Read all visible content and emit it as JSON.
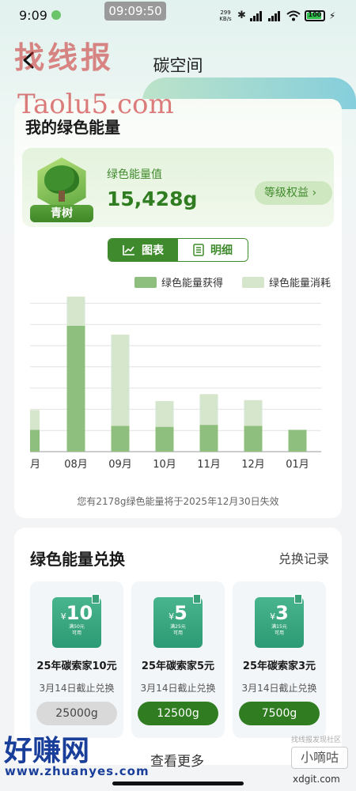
{
  "status_bar": {
    "time": "9:09",
    "timer": "09:09:50",
    "net_speed_value": "299",
    "net_speed_unit": "KB/s",
    "battery": "100"
  },
  "header": {
    "title": "碳空间"
  },
  "watermarks": {
    "top": "找线报",
    "top_url": "Taolu5.com",
    "bottom": "好赚网",
    "bottom_url": "www.zhuanyes.com",
    "right_small": "找线报发现社区",
    "right_box": "小嘀咕",
    "right_url": "xdgit.com"
  },
  "energy": {
    "title": "我的绿色能量",
    "level_badge": "青树",
    "value_label": "绿色能量值",
    "value": "15,428g",
    "level_button": "等级权益 ›",
    "tabs": [
      {
        "label": "图表",
        "active": true,
        "icon": "chart-icon"
      },
      {
        "label": "明细",
        "active": false,
        "icon": "list-icon"
      }
    ],
    "expire_note": "您有2178g绿色能量将于2025年12月30日失效"
  },
  "chart_data": {
    "type": "bar",
    "stacked": true,
    "categories": [
      "月",
      "08月",
      "09月",
      "10月",
      "11月",
      "12月",
      "01月"
    ],
    "series": [
      {
        "name": "绿色能量获得",
        "color": "#8fbf7f",
        "values": [
          22,
          127,
          26,
          25,
          27,
          26,
          22
        ]
      },
      {
        "name": "绿色能量消耗",
        "color": "#d6e6cd",
        "values": [
          20,
          30,
          92,
          26,
          31,
          26,
          0
        ]
      }
    ],
    "ylim": [
      0,
      150
    ],
    "grid": true,
    "legend": "top-right"
  },
  "exchange": {
    "title": "绿色能量兑换",
    "record_link": "兑换记录",
    "see_more": "查看更多",
    "coupons": [
      {
        "currency": "¥",
        "amount": "10",
        "threshold": "满50元",
        "usable": "可用",
        "name": "25年碳索家10元",
        "deadline": "3月14日截止兑换",
        "cost": "25000g",
        "enabled": false
      },
      {
        "currency": "¥",
        "amount": "5",
        "threshold": "满25元",
        "usable": "可用",
        "name": "25年碳索家5元",
        "deadline": "3月14日截止兑换",
        "cost": "12500g",
        "enabled": true
      },
      {
        "currency": "¥",
        "amount": "3",
        "threshold": "满15元",
        "usable": "可用",
        "name": "25年碳索家3元",
        "deadline": "3月14日截止兑换",
        "cost": "7500g",
        "enabled": true
      }
    ]
  }
}
